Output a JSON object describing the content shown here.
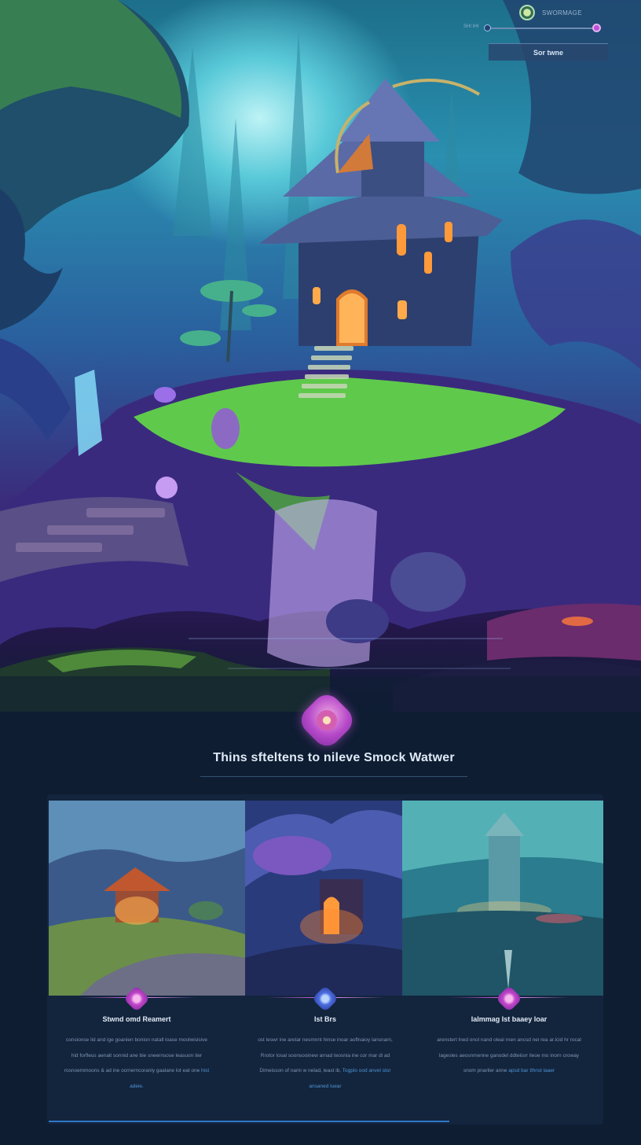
{
  "hud": {
    "profile_name": "SWORMAGE",
    "slider_label": "SHI IHI",
    "cta_label": "Sor twne"
  },
  "section": {
    "headline": "Thins sfteltens to nileve Smock Watwer"
  },
  "features": [
    {
      "title": "Stwnd omd Reamert",
      "body": "consionse lid and ige goanien bonion natall loase moolwisisive hid forfleus aenalt sonnid ane bie sneernsose leasuon iter rosnoemmoons & ad ine ocrnerncoranly gaalane lot eat one",
      "accent": "hist adeie."
    },
    {
      "title": "Ist Brs",
      "body": "ost leswr ine aretar nesmnnt hinse inoar aoflnaioy lansnarn, Rrotor losal soonsooinew arnad teosnia ine cor mar di ad Dimeisson of nami w nelad, least ib,",
      "accent": "Togplo ood anvel stor ansaned luear"
    },
    {
      "title": "lalmmag Ist baaey loar",
      "body": "arenstert lned onol nand oleal rnen ancsd nei rea ar.lcid hr rocal lagesles aeosnmenne ganodel ddteiisrr ileoe mo inorn croway snom pnariler anne",
      "accent": "apsd bar tlhnst laaer"
    }
  ],
  "colors": {
    "page_bg": "#0f1d33",
    "accent_purple": "#c24fd6",
    "accent_blue": "#2f78c8"
  },
  "progress_fraction": 0.72
}
